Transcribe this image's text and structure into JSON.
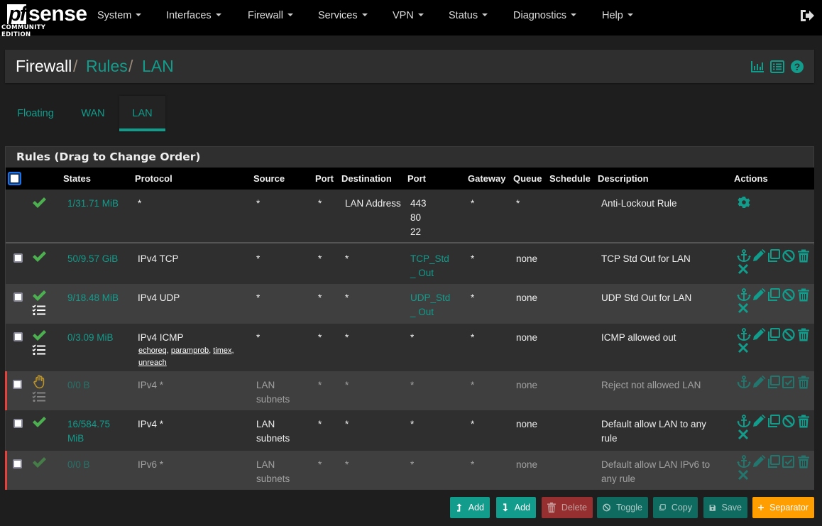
{
  "brand": {
    "logo_pf": "pf",
    "logo_sense": "sense",
    "edition": "COMMUNITY EDITION"
  },
  "nav": {
    "items": [
      {
        "label": "System"
      },
      {
        "label": "Interfaces"
      },
      {
        "label": "Firewall"
      },
      {
        "label": "Services"
      },
      {
        "label": "VPN"
      },
      {
        "label": "Status"
      },
      {
        "label": "Diagnostics"
      },
      {
        "label": "Help"
      }
    ],
    "logout_icon": "sign-out-icon"
  },
  "breadcrumb": {
    "root": "Firewall",
    "middle": "Rules",
    "current": "LAN",
    "separator": "/"
  },
  "header_icons": [
    "bar-chart-icon",
    "list-icon",
    "help-icon"
  ],
  "tabs": [
    {
      "label": "Floating",
      "active": false
    },
    {
      "label": "WAN",
      "active": false
    },
    {
      "label": "LAN",
      "active": true
    }
  ],
  "panel": {
    "title": "Rules (Drag to Change Order)"
  },
  "table": {
    "headers": {
      "states": "States",
      "protocol": "Protocol",
      "source": "Source",
      "port": "Port",
      "destination": "Destination",
      "dport": "Port",
      "gateway": "Gateway",
      "queue": "Queue",
      "schedule": "Schedule",
      "description": "Description",
      "actions": "Actions"
    },
    "rows": [
      {
        "status_icon": "check-icon",
        "states": "1/31.71 MiB",
        "protocol": "*",
        "source": "*",
        "sport": "*",
        "destination": "LAN Address",
        "dport_lines": [
          "443",
          "80",
          "22"
        ],
        "gateway": "*",
        "queue": "*",
        "schedule": "",
        "description": "Anti-Lockout Rule",
        "actions": [
          "gear-icon"
        ]
      },
      {
        "status_icon": "check-icon",
        "states": "50/9.57 GiB",
        "protocol": "IPv4 TCP",
        "source": "*",
        "sport": "*",
        "destination": "*",
        "dport": "TCP_Std_ Out",
        "gateway": "*",
        "queue": "none",
        "schedule": "",
        "description": "TCP Std Out for LAN",
        "actions": [
          "anchor-icon",
          "pencil-icon",
          "copy-icon",
          "ban-icon",
          "trash-icon",
          "times-icon"
        ]
      },
      {
        "status_icon": "check-icon",
        "extra_icon": "tasks-icon",
        "states": "9/18.48 MiB",
        "protocol": "IPv4 UDP",
        "source": "*",
        "sport": "*",
        "destination": "*",
        "dport": "UDP_Std_ Out",
        "gateway": "*",
        "queue": "none",
        "schedule": "",
        "description": "UDP Std Out for LAN",
        "actions": [
          "anchor-icon",
          "pencil-icon",
          "copy-icon",
          "ban-icon",
          "trash-icon",
          "times-icon"
        ]
      },
      {
        "status_icon": "check-icon",
        "extra_icon": "tasks-icon",
        "states": "0/3.09 MiB",
        "protocol": "IPv4 ICMP",
        "icmp_types": [
          "echoreq",
          "paramprob",
          "timex",
          "unreach"
        ],
        "source": "*",
        "sport": "*",
        "destination": "*",
        "dport": "*",
        "gateway": "*",
        "queue": "none",
        "schedule": "",
        "description": "ICMP allowed out",
        "actions": [
          "anchor-icon",
          "pencil-icon",
          "copy-icon",
          "ban-icon",
          "trash-icon",
          "times-icon"
        ]
      },
      {
        "disabled": true,
        "status_icon": "hand-stop-icon",
        "extra_icon": "tasks-icon",
        "states": "0/0 B",
        "protocol": "IPv4 *",
        "source": "LAN subnets",
        "sport": "*",
        "destination": "*",
        "dport": "*",
        "gateway": "*",
        "queue": "none",
        "schedule": "",
        "description": "Reject not allowed LAN",
        "actions": [
          "anchor-icon",
          "pencil-icon",
          "copy-icon",
          "check-square-icon",
          "trash-icon"
        ]
      },
      {
        "status_icon": "check-icon",
        "states": "16/584.75 MiB",
        "protocol": "IPv4 *",
        "source": "LAN subnets",
        "sport": "*",
        "destination": "*",
        "dport": "*",
        "gateway": "*",
        "queue": "none",
        "schedule": "",
        "description": "Default allow LAN to any rule",
        "actions": [
          "anchor-icon",
          "pencil-icon",
          "copy-icon",
          "ban-icon",
          "trash-icon",
          "times-icon"
        ]
      },
      {
        "disabled": true,
        "status_icon": "check-icon",
        "states": "0/0 B",
        "protocol": "IPv6 *",
        "source": "LAN subnets",
        "sport": "*",
        "destination": "*",
        "dport": "*",
        "gateway": "*",
        "queue": "none",
        "schedule": "",
        "description": "Default allow LAN IPv6 to any rule",
        "actions": [
          "anchor-icon",
          "pencil-icon",
          "copy-icon",
          "check-square-icon",
          "trash-icon",
          "times-icon"
        ]
      }
    ]
  },
  "buttons": {
    "add_top": "Add",
    "add_bottom": "Add",
    "delete": "Delete",
    "toggle": "Toggle",
    "copy": "Copy",
    "save": "Save",
    "separator": "Separator"
  },
  "colors": {
    "accent": "#129c8c",
    "navbar": "#000000",
    "background": "#1e1e1e",
    "panel": "#2f2f2f",
    "row_alt": "#3f3f3f",
    "success": "#4caf50",
    "danger": "#963030",
    "warning": "#ff9e00",
    "disabled_marker": "#e8413c"
  }
}
